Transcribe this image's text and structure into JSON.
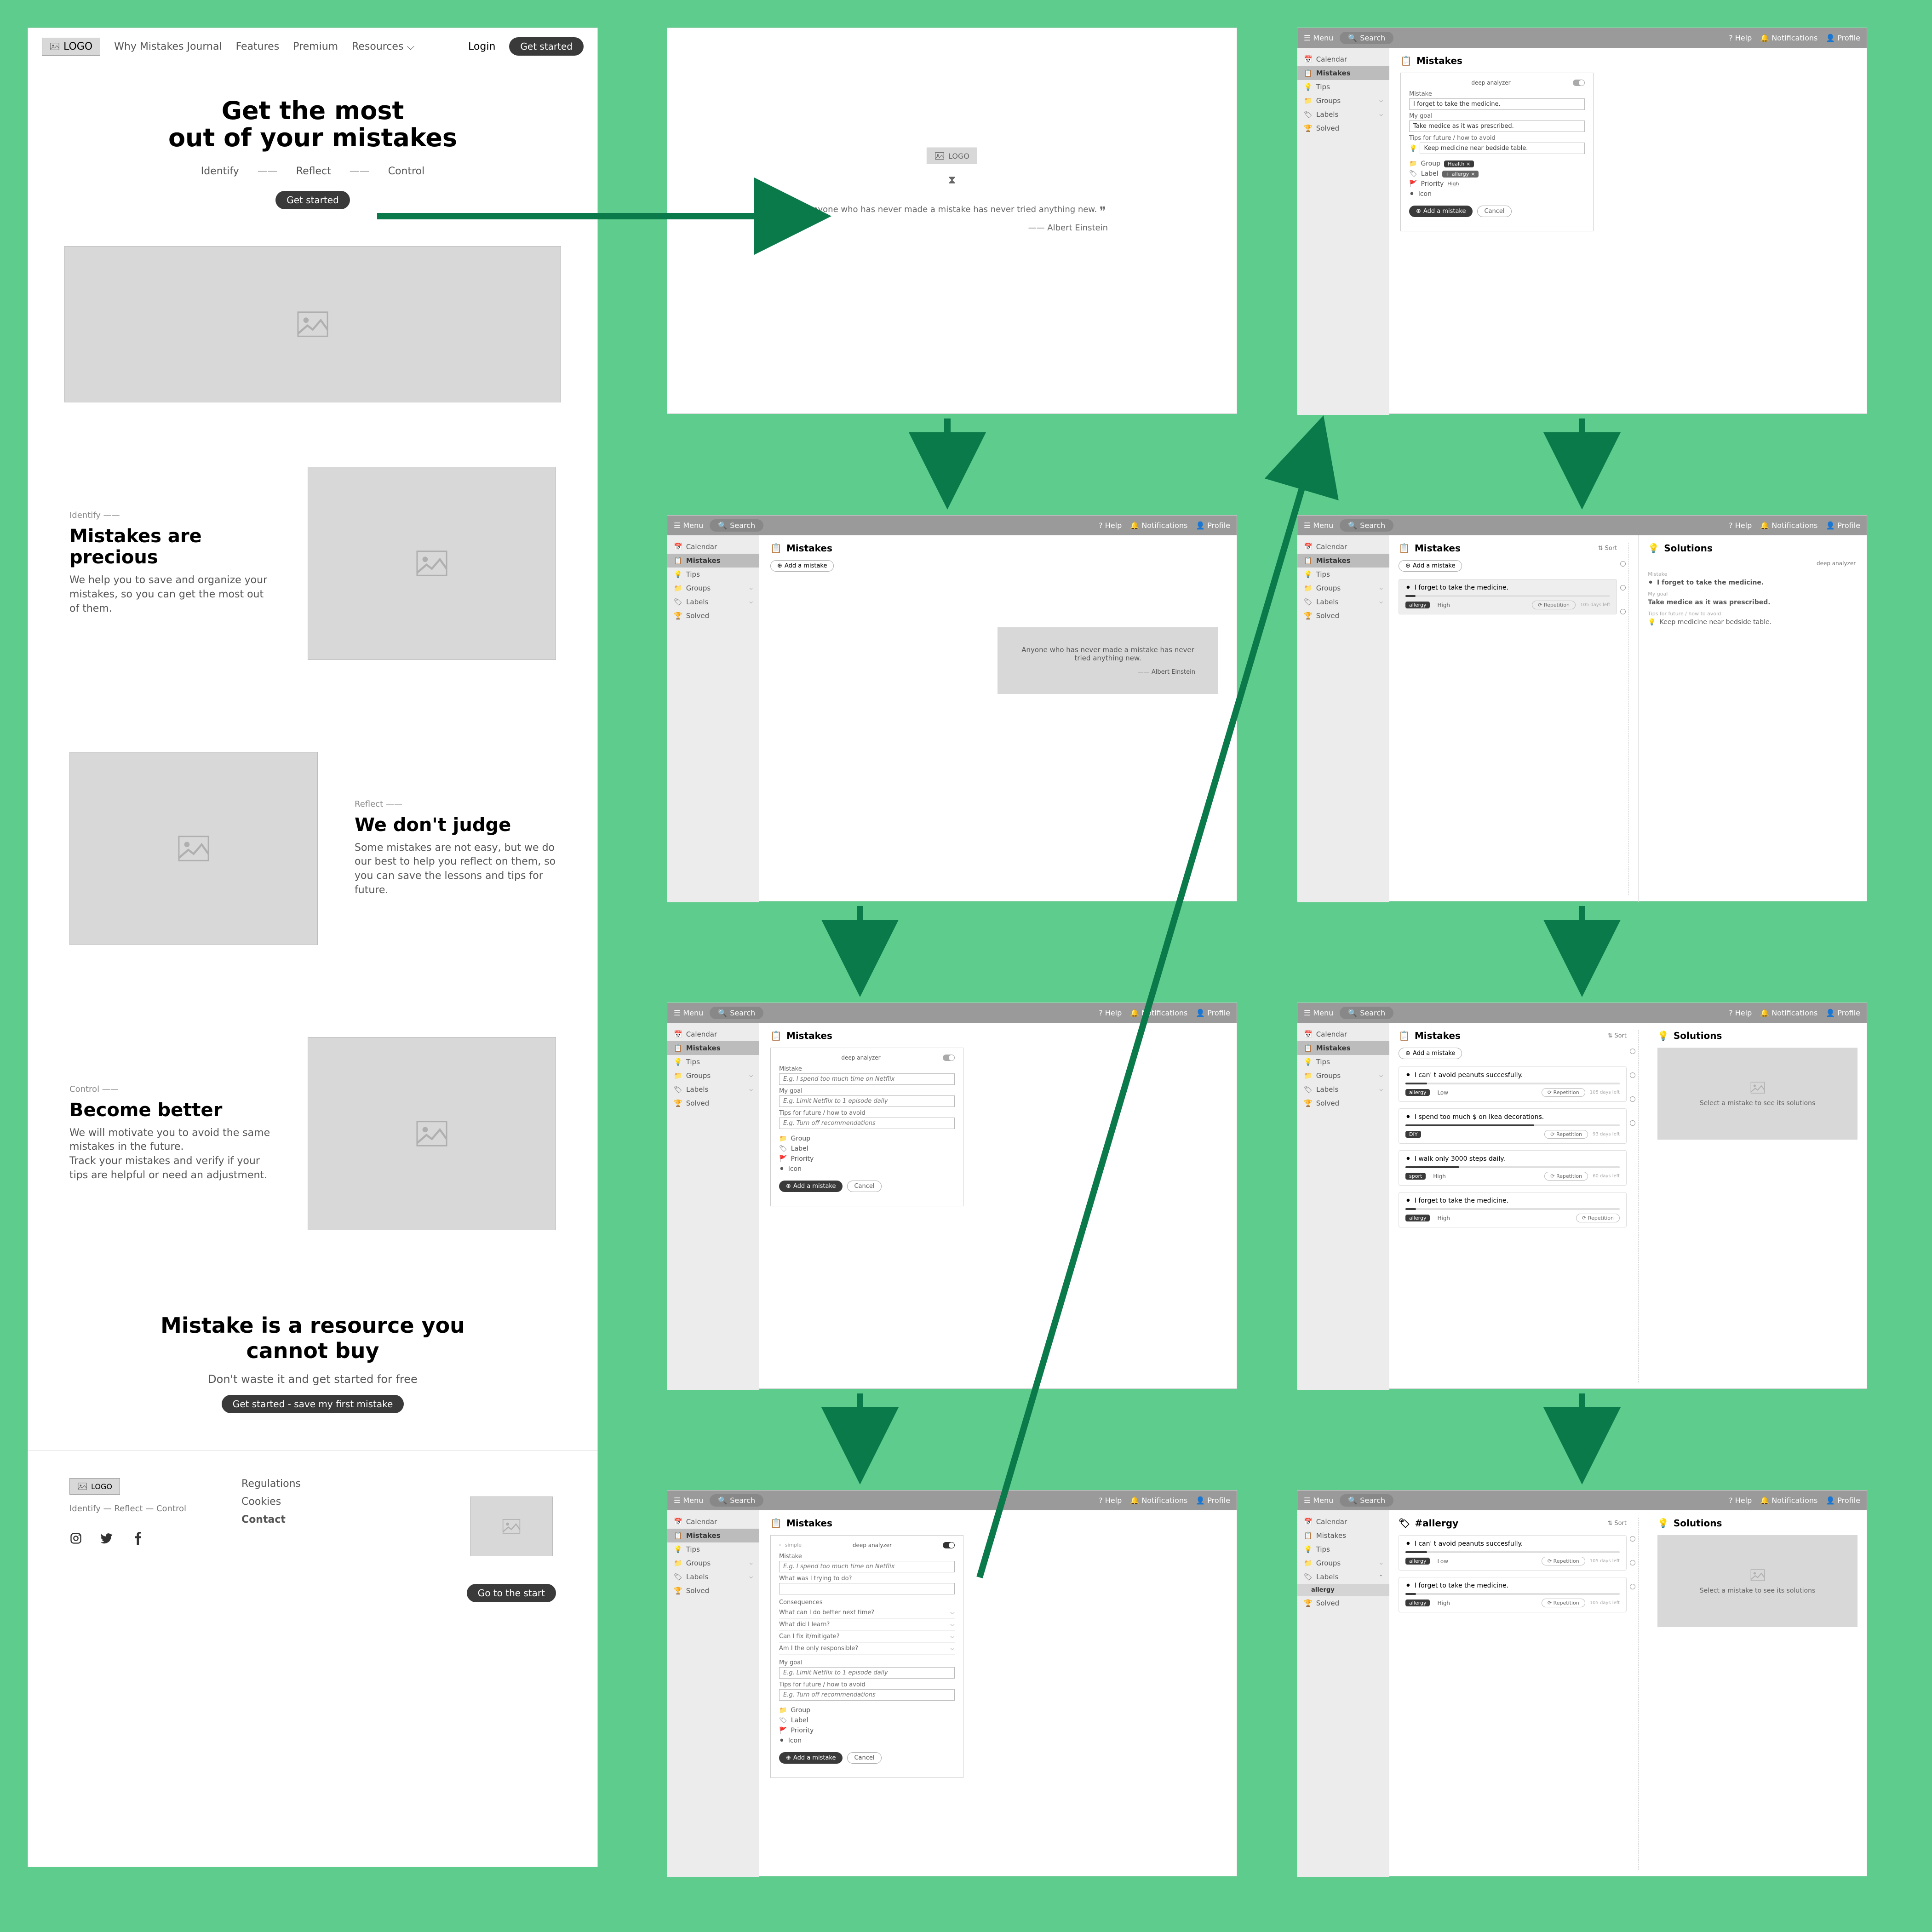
{
  "landing": {
    "logo": "LOGO",
    "nav": [
      "Why Mistakes Journal",
      "Features",
      "Premium",
      "Resources"
    ],
    "login": "Login",
    "getstarted": "Get started",
    "hero1": "Get the most",
    "hero2": "out of your mistakes",
    "steps": [
      "Identify",
      "Reflect",
      "Control"
    ],
    "s1_tag": "Identify   ——",
    "s1_h": "Mistakes are precious",
    "s1_p": "We help you to save and organize your mistakes, so you can get the most out of them.",
    "s2_tag": "Reflect   ——",
    "s2_h": "We don't judge",
    "s2_p": "Some mistakes are not easy, but we do our best to help you reflect on them, so you can save the lessons and tips for future.",
    "s3_tag": "Control   ——",
    "s3_h": "Become better",
    "s3_p1": "We will motivate you to avoid the same mistakes in the future.",
    "s3_p2": "Track your mistakes and verify if your tips are helpful or need an adjustment.",
    "cta_h1": "Mistake is a resource you",
    "cta_h2": "cannot buy",
    "cta_p": "Don't waste it and get started for free",
    "cta_btn": "Get started - save my first mistake",
    "foot_reg": "Regulations",
    "foot_cook": "Cookies",
    "foot_contact": "Contact",
    "foot_steps": "Identify — Reflect — Control",
    "scrolltop": "Go to the start"
  },
  "app": {
    "menu": "Menu",
    "search": "Search",
    "help": "Help",
    "notif": "Notifications",
    "profile": "Profile",
    "side": {
      "calendar": "Calendar",
      "mistakes": "Mistakes",
      "tips": "Tips",
      "groups": "Groups",
      "labels": "Labels",
      "solved": "Solved",
      "allergy": "allergy"
    },
    "title_mistakes": "Mistakes",
    "title_solutions": "Solutions",
    "title_allergy": "#allergy",
    "add": "Add a mistake",
    "cancel": "Cancel",
    "sort": "Sort",
    "deep": "deep analyzer",
    "quote": "Anyone who has never made a mistake has never tried anything new.",
    "author": "——   Albert Einstein",
    "form": {
      "mistake_l": "Mistake",
      "mistake_ph": "E.g. I spend too much time on Netflix",
      "mistake_v": "I forget to take the medicine.",
      "goal_l": "My goal",
      "goal_ph": "E.g. Limit Netflix to 1 episode daily",
      "goal_v": "Take medice as it was prescribed.",
      "tips_l": "Tips for future / how to avoid",
      "tips_ph": "E.g. Turn off recommendations",
      "tips_v": "Keep medicine near bedside table.",
      "trying_l": "What was I trying to do?",
      "conseq_l": "Consequences",
      "q1": "What can I do better next time?",
      "q2": "What did I learn?",
      "q3": "Can I fix it/mitigate?",
      "q4": "Am I the only responsible?",
      "group": "Group",
      "label": "Label",
      "priority": "Priority",
      "icon": "Icon",
      "chip_health": "Health",
      "chip_allergy": "allergy",
      "prio_high": "High",
      "prio_low": "Low"
    },
    "entries": {
      "med": "I forget to take the medicine.",
      "peanuts": "I can' t avoid peanuts succesfully.",
      "decor": "I spend too much $ on Ikea decorations.",
      "steps": "I walk only 3000 steps daily.",
      "rep": "Repetition",
      "date1": "105 days left",
      "date2": "93 days left",
      "date3": "60 days left"
    },
    "solph": "Select a mistake to see its solutions"
  }
}
